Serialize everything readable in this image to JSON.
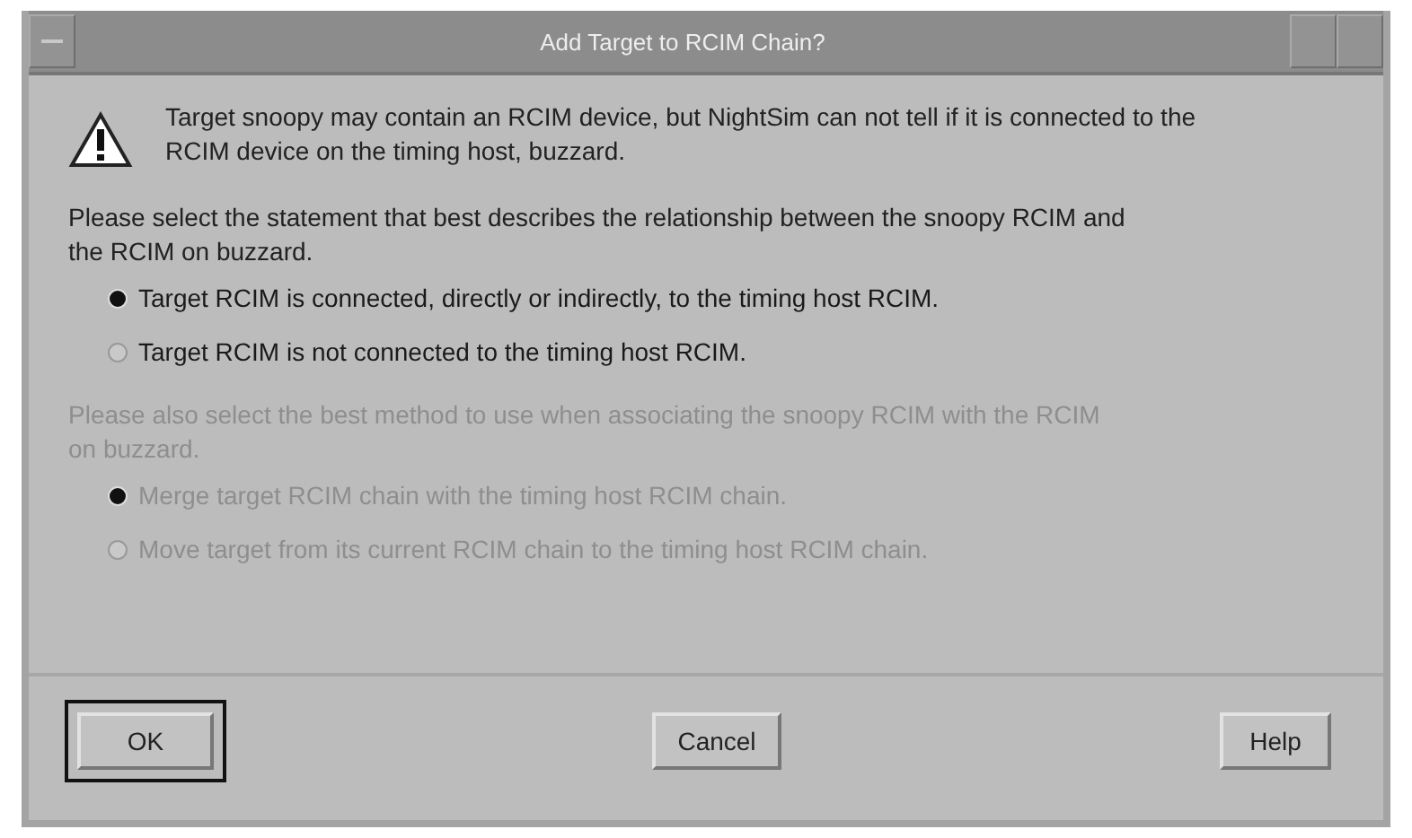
{
  "window": {
    "title": "Add Target to RCIM Chain?"
  },
  "message": "Target snoopy may contain an RCIM device, but NightSim can not tell if it is connected to the RCIM device on the timing host, buzzard.",
  "groups": [
    {
      "prompt": "Please select the statement that best describes the relationship between the snoopy RCIM and the RCIM on buzzard.",
      "disabled": false,
      "options": [
        {
          "label": "Target RCIM is connected, directly or indirectly, to the timing host RCIM.",
          "selected": true
        },
        {
          "label": "Target RCIM is not connected to the timing host RCIM.",
          "selected": false
        }
      ]
    },
    {
      "prompt": "Please also select the best method to use when associating the snoopy RCIM with the RCIM on buzzard.",
      "disabled": true,
      "options": [
        {
          "label": "Merge target RCIM chain with the timing host RCIM chain.",
          "selected": true
        },
        {
          "label": "Move target from its current RCIM chain to the timing host RCIM chain.",
          "selected": false
        }
      ]
    }
  ],
  "buttons": [
    {
      "label": "OK",
      "default": true
    },
    {
      "label": "Cancel",
      "default": false
    },
    {
      "label": "Help",
      "default": false
    }
  ]
}
